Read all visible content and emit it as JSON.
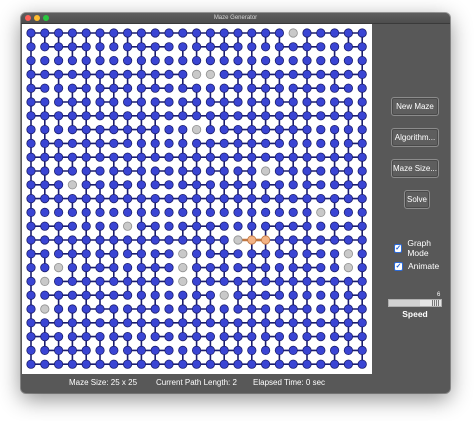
{
  "window": {
    "title": "Maze Generator"
  },
  "maze": {
    "rows": 25,
    "cols": 25,
    "colors": {
      "node_fill": "#3a45d4",
      "node_stroke": "#1a1d6e",
      "edge": "#1a1d6e",
      "unvisited_fill": "#c9c9c9",
      "path_fill": "#f3b385",
      "path_stroke": "#c27740"
    },
    "unvisited_cells": [
      [
        0,
        19
      ],
      [
        3,
        12
      ],
      [
        3,
        13
      ],
      [
        7,
        12
      ],
      [
        10,
        17
      ],
      [
        11,
        3
      ],
      [
        13,
        21
      ],
      [
        14,
        7
      ],
      [
        15,
        15
      ],
      [
        16,
        11
      ],
      [
        16,
        23
      ],
      [
        17,
        2
      ],
      [
        17,
        11
      ],
      [
        17,
        23
      ],
      [
        18,
        1
      ],
      [
        18,
        11
      ],
      [
        19,
        14
      ],
      [
        20,
        1
      ]
    ],
    "current_path": [
      [
        15,
        16
      ],
      [
        15,
        17
      ]
    ],
    "path_edges": [
      [
        [
          15,
          15
        ],
        [
          15,
          16
        ]
      ],
      [
        [
          15,
          16
        ],
        [
          15,
          17
        ]
      ]
    ]
  },
  "controls": {
    "new_maze_label": "New Maze",
    "algorithm_label": "Algorithm...",
    "maze_size_label": "Maze Size...",
    "solve_label": "Solve",
    "graph_mode_label": "Graph Mode",
    "graph_mode_checked": true,
    "animate_label": "Animate",
    "animate_checked": true,
    "speed_label": "Speed",
    "speed_value": "6",
    "speed_fraction": 0.6
  },
  "status": {
    "maze_size": "Maze Size: 25 x 25",
    "path_length": "Current Path Length: 2",
    "elapsed": "Elapsed Time: 0 sec"
  }
}
